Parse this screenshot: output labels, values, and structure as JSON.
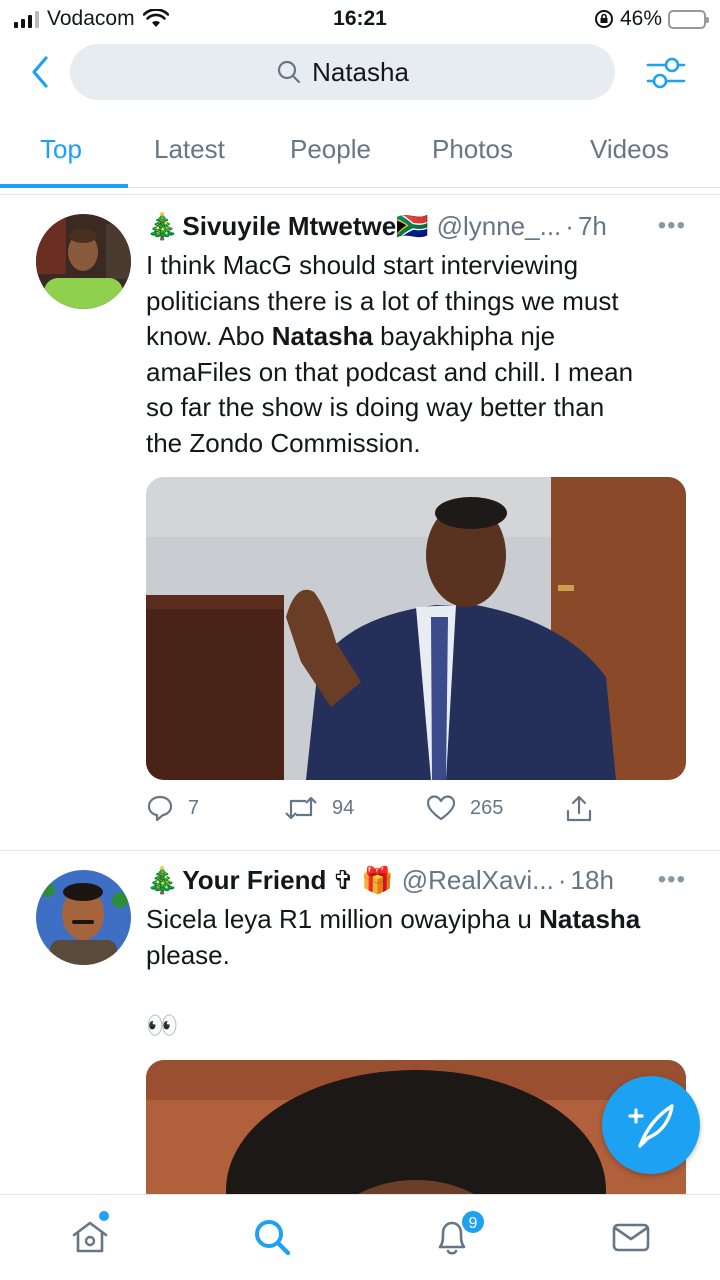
{
  "status_bar": {
    "carrier": "Vodacom",
    "time": "16:21",
    "battery": "46%",
    "battery_level": 0.46
  },
  "search": {
    "query": "Natasha"
  },
  "tabs": [
    {
      "label": "Top",
      "active": true
    },
    {
      "label": "Latest",
      "active": false
    },
    {
      "label": "People",
      "active": false
    },
    {
      "label": "Photos",
      "active": false
    },
    {
      "label": "Videos",
      "active": false
    }
  ],
  "tweets": [
    {
      "emoji_prefix": "🎄",
      "name": "Sivuyile Mtwetwe",
      "name_suffix": "🇿🇦",
      "handle": "@lynne_...",
      "time": "7h",
      "more": "•••",
      "text_lines": [
        "I think MacG should start interviewing",
        "politicians there is a lot of things we must",
        "know. Abo ",
        "Natasha",
        " bayakhipha nje",
        "amaFiles on that podcast and chill. I mean",
        "so far the show is doing way better than",
        "the Zondo Commission."
      ],
      "replies": "7",
      "retweets": "94",
      "likes": "265"
    },
    {
      "emoji_prefix": "🎄",
      "name": "Your Friend",
      "name_suffix": "✞ 🎁",
      "handle": "@RealXavi...",
      "time": "18h",
      "more": "•••",
      "text_line1_a": "Sicela leya R1 million owayipha u ",
      "text_line1_b": "Natasha",
      "text_line2": "please.",
      "text_line3": "👀"
    }
  ],
  "nav": {
    "notifications_count": "9"
  },
  "colors": {
    "accent": "#1da1f2",
    "muted": "#657786",
    "text": "#14171a",
    "search_bg": "#e6ecf0"
  }
}
